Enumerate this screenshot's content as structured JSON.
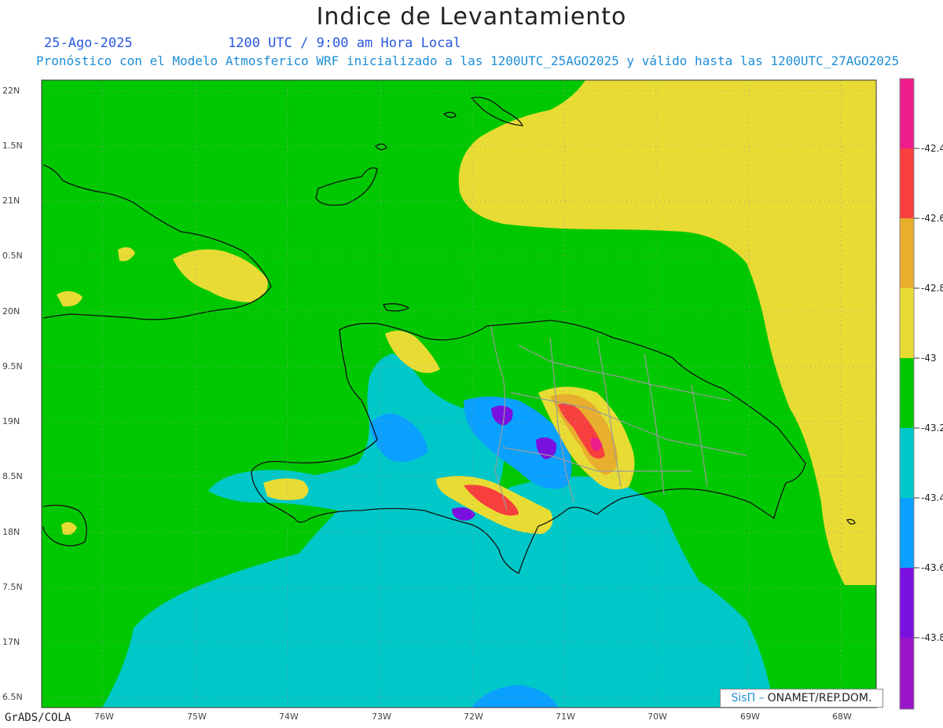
{
  "header": {
    "title": "Indice de Levantamiento",
    "date": "25-Ago-2025",
    "time": "1200 UTC / 9:00 am Hora Local",
    "subtitle": "Pronóstico con el Modelo Atmosferico WRF inicializado a las 1200UTC_25AGO2025 y válido hasta las  1200UTC_27AGO2025"
  },
  "axes": {
    "lat_labels": [
      "22N",
      "1.5N",
      "21N",
      "0.5N",
      "20N",
      "9.5N",
      "19N",
      "8.5N",
      "18N",
      "7.5N",
      "17N",
      "6.5N"
    ],
    "lon_labels": [
      "76W",
      "75W",
      "74W",
      "73W",
      "72W",
      "71W",
      "70W",
      "69W",
      "68W"
    ]
  },
  "colorbar": {
    "labels": [
      "-42.4",
      "-42.6",
      "-42.8",
      "-43",
      "-43.2",
      "-43.4",
      "-43.6",
      "-43.8"
    ],
    "colors": [
      "#ee1c8c",
      "#f7403e",
      "#e8ae2d",
      "#e8dc34",
      "#00c800",
      "#00c8c8",
      "#0aa0ff",
      "#7a10e0",
      "#9a14c8"
    ]
  },
  "credit": {
    "brand": "SisΠ –",
    "org": "ONAMET/REP.DOM."
  },
  "footer": {
    "software": "GrADS/COLA"
  }
}
